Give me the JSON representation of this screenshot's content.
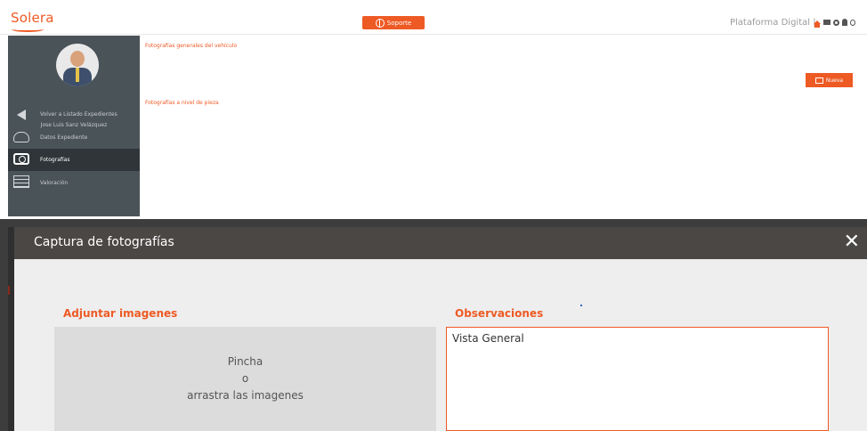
{
  "header": {
    "logo_text": "Solera",
    "support_label": "Soporte",
    "platform_label": "Plataforma Digital |",
    "icons": [
      "home-icon",
      "mail-icon",
      "gear-icon",
      "user-icon",
      "logout-icon"
    ],
    "accent_color": "#ee5a24"
  },
  "sidebar": {
    "username": "Jose Luis Sanz Velázquez",
    "items": [
      {
        "label": "Volver a Listado Expedientes",
        "icon": "back-arrow-icon",
        "active": false
      },
      {
        "label": "Datos Expediente",
        "icon": "cloud-icon",
        "active": false
      },
      {
        "label": "Fotografías",
        "icon": "camera-icon",
        "active": true
      },
      {
        "label": "Valoración",
        "icon": "abacus-icon",
        "active": false
      }
    ]
  },
  "main": {
    "section_general": "Fotografías generales del vehículo",
    "section_piece": "Fotografías a nivel de pieza",
    "new_button_label": "Nueva"
  },
  "modal": {
    "title": "Captura de fotografías",
    "close_symbol": "✕",
    "attach_label": "Adjuntar imagenes",
    "dropzone_line1": "Pincha",
    "dropzone_line2": "o",
    "dropzone_line3": "arrastra las imagenes",
    "observations_label": "Observaciones",
    "observations_value": "Vista General"
  }
}
